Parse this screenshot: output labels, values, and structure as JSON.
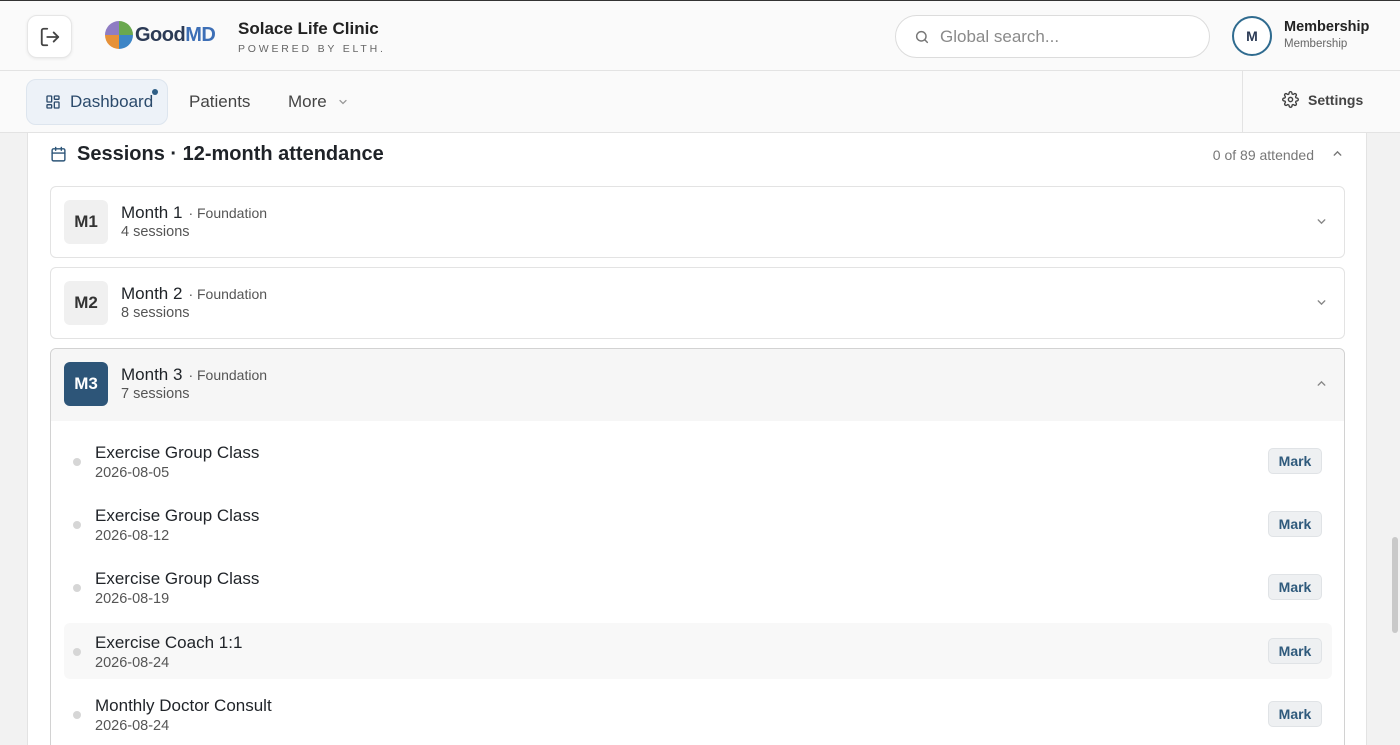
{
  "header": {
    "logo_text_a": "Good",
    "logo_text_b": "MD",
    "clinic_name": "Solace Life Clinic",
    "clinic_sub": "POWERED BY ELTH.",
    "search_placeholder": "Global search...",
    "avatar_initial": "M",
    "member_title": "Membership",
    "member_sub": "Membership"
  },
  "nav": {
    "dashboard": "Dashboard",
    "patients": "Patients",
    "more": "More",
    "settings": "Settings"
  },
  "sessions": {
    "title": "Sessions · 12-month attendance",
    "attended": "0 of 89 attended",
    "months": [
      {
        "badge": "M1",
        "name": "Month 1",
        "phase": "· Foundation",
        "count": "4 sessions",
        "expanded": false
      },
      {
        "badge": "M2",
        "name": "Month 2",
        "phase": "· Foundation",
        "count": "8 sessions",
        "expanded": false
      },
      {
        "badge": "M3",
        "name": "Month 3",
        "phase": "· Foundation",
        "count": "7 sessions",
        "expanded": true
      }
    ],
    "month3_items": [
      {
        "name": "Exercise Group Class",
        "date": "2026-08-05",
        "action": "Mark"
      },
      {
        "name": "Exercise Group Class",
        "date": "2026-08-12",
        "action": "Mark"
      },
      {
        "name": "Exercise Group Class",
        "date": "2026-08-19",
        "action": "Mark"
      },
      {
        "name": "Exercise Coach 1:1",
        "date": "2026-08-24",
        "action": "Mark"
      },
      {
        "name": "Monthly Doctor Consult",
        "date": "2026-08-24",
        "action": "Mark"
      }
    ]
  },
  "colors": {
    "accent": "#2d5578",
    "badge_inactive": "#f0f0f0",
    "dot": "#d6d6d6"
  }
}
